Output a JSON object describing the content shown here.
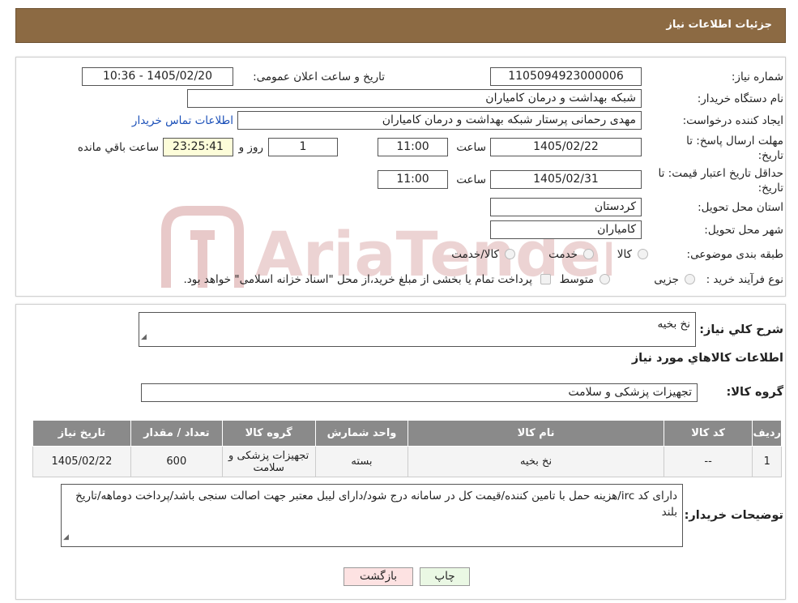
{
  "header": {
    "title": "جزئیات اطلاعات نیاز"
  },
  "form": {
    "need_number_label": "شماره نیاز:",
    "need_number": "1105094923000006",
    "announce_label": "تاریخ و ساعت اعلان عمومی:",
    "announce_value": "1405/02/20 - 10:36",
    "buyer_org_label": "نام دستگاه خریدار:",
    "buyer_org": "شبکه بهداشت و درمان کامیاران",
    "creator_label": "ایجاد کننده درخواست:",
    "creator": "مهدی رحمانی پرستار شبکه بهداشت و درمان کامیاران",
    "contact_link": "اطلاعات تماس خریدار",
    "deadline_label_1": "مهلت ارسال پاسخ: تا",
    "deadline_label_2": "تاریخ:",
    "deadline_date": "1405/02/22",
    "time_label": "ساعت",
    "deadline_time": "11:00",
    "days_value": "1",
    "days_label": "روز و",
    "remaining_time": "23:25:41",
    "remaining_label": "ساعت باقي مانده",
    "validity_label_1": "حداقل تاریخ اعتبار قیمت: تا",
    "validity_label_2": "تاریخ:",
    "validity_date": "1405/02/31",
    "validity_time": "11:00",
    "province_label": "استان محل تحویل:",
    "province": "کردستان",
    "city_label": "شهر محل تحویل:",
    "city": "کامیاران",
    "category_label": "طبقه بندی موضوعی:",
    "category_options": [
      "کالا",
      "خدمت",
      "کالا/خدمت"
    ],
    "process_label": "نوع فرآیند خرید :",
    "process_options": [
      "جزیی",
      "متوسط"
    ],
    "process_note": "پرداخت تمام یا بخشی از مبلغ خرید،از محل \"اسناد خزانه اسلامی\" خواهد بود."
  },
  "watermark": {
    "text": "AriaTender.neT"
  },
  "details": {
    "description_label": "شرح كلي نياز:",
    "description": "نخ بخیه",
    "goods_info_title": "اطلاعات کالاهاي مورد نياز",
    "goods_group_label": "گروه کالا:",
    "goods_group": "تجهیزات پزشکی و سلامت"
  },
  "table": {
    "headers": [
      "رديف",
      "کد کالا",
      "نام کالا",
      "واحد شمارش",
      "گروه کالا",
      "تعداد / مقدار",
      "تاریخ نیاز"
    ],
    "rows": [
      [
        "1",
        "--",
        "نخ بخیه",
        "بسته",
        "تجهیزات پزشکی و سلامت",
        "600",
        "1405/02/22"
      ]
    ]
  },
  "buyer_notes": {
    "label": "توضیحات خریدار:",
    "text": "دارای کد irc/هزینه حمل با تامین کننده/قیمت کل در سامانه درج شود/دارای لیبل معتبر جهت اصالت سنجی باشد/پرداخت دوماهه/تاریخ بلند"
  },
  "buttons": {
    "print": "چاپ",
    "back": "بازگشت"
  },
  "colors": {
    "header_bg": "#8c6a43",
    "table_header_bg": "#8a8a8a",
    "link": "#1a4fb8",
    "watermark": "#e8c9c9"
  }
}
